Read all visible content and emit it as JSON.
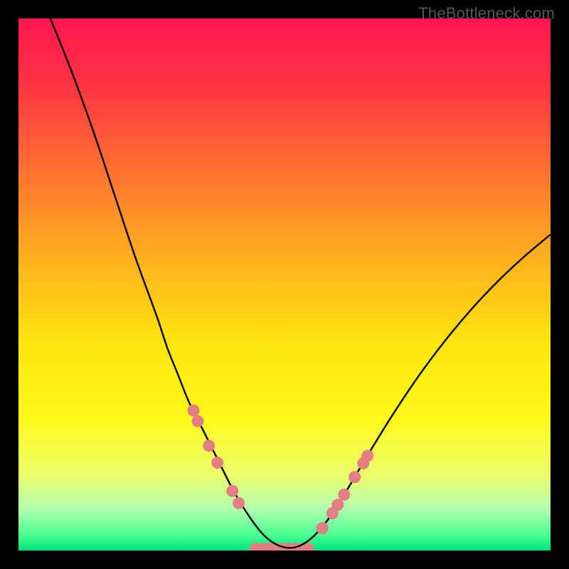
{
  "watermark": "TheBottleneck.com",
  "chart_data": {
    "type": "line",
    "title": "",
    "xlabel": "",
    "ylabel": "",
    "xlim": [
      0,
      100
    ],
    "ylim": [
      0,
      100
    ],
    "grid": false,
    "legend": false,
    "background_gradient": {
      "stops": [
        {
          "offset": 0.0,
          "color": "#ff1750"
        },
        {
          "offset": 0.12,
          "color": "#ff3244"
        },
        {
          "offset": 0.28,
          "color": "#ff6f32"
        },
        {
          "offset": 0.45,
          "color": "#ffb01f"
        },
        {
          "offset": 0.62,
          "color": "#ffe70e"
        },
        {
          "offset": 0.75,
          "color": "#fff91a"
        },
        {
          "offset": 0.86,
          "color": "#eaff6f"
        },
        {
          "offset": 0.92,
          "color": "#b6ffb0"
        },
        {
          "offset": 0.97,
          "color": "#4bff94"
        },
        {
          "offset": 1.0,
          "color": "#00e47a"
        }
      ]
    },
    "series": [
      {
        "name": "curve",
        "color": "#000000",
        "x": [
          6,
          10,
          14,
          18,
          22,
          26,
          28,
          30,
          32,
          34,
          36,
          38,
          40,
          42,
          44,
          46,
          48,
          50,
          52,
          54,
          56,
          58,
          60,
          62,
          66,
          70,
          75,
          80,
          85,
          90,
          95,
          100
        ],
        "y": [
          100,
          90,
          79,
          67,
          55,
          44,
          38,
          33,
          28,
          24,
          20,
          16,
          12,
          8.5,
          5.5,
          3,
          1.4,
          0.6,
          0.6,
          1.5,
          3.2,
          5.6,
          8.5,
          11.8,
          18.5,
          25,
          32.5,
          39.2,
          45.2,
          50.5,
          55.2,
          59.4
        ]
      }
    ],
    "markers_left": {
      "color": "#e37f82",
      "points": [
        {
          "x": 32.9,
          "y": 26.3
        },
        {
          "x": 33.7,
          "y": 24.3
        },
        {
          "x": 35.8,
          "y": 19.7
        },
        {
          "x": 37.4,
          "y": 16.5
        },
        {
          "x": 40.2,
          "y": 11.2
        },
        {
          "x": 41.4,
          "y": 8.9
        }
      ]
    },
    "markers_right": {
      "color": "#e37f82",
      "points": [
        {
          "x": 57.1,
          "y": 4.2
        },
        {
          "x": 59.0,
          "y": 7.0
        },
        {
          "x": 60.0,
          "y": 8.6
        },
        {
          "x": 61.2,
          "y": 10.5
        },
        {
          "x": 63.2,
          "y": 13.8
        },
        {
          "x": 64.8,
          "y": 16.4
        },
        {
          "x": 65.6,
          "y": 17.8
        }
      ]
    },
    "bottom_cluster": {
      "color": "#e37f82",
      "x_start": 44.6,
      "x_end": 54.4,
      "y": 0.25,
      "count": 9
    }
  }
}
